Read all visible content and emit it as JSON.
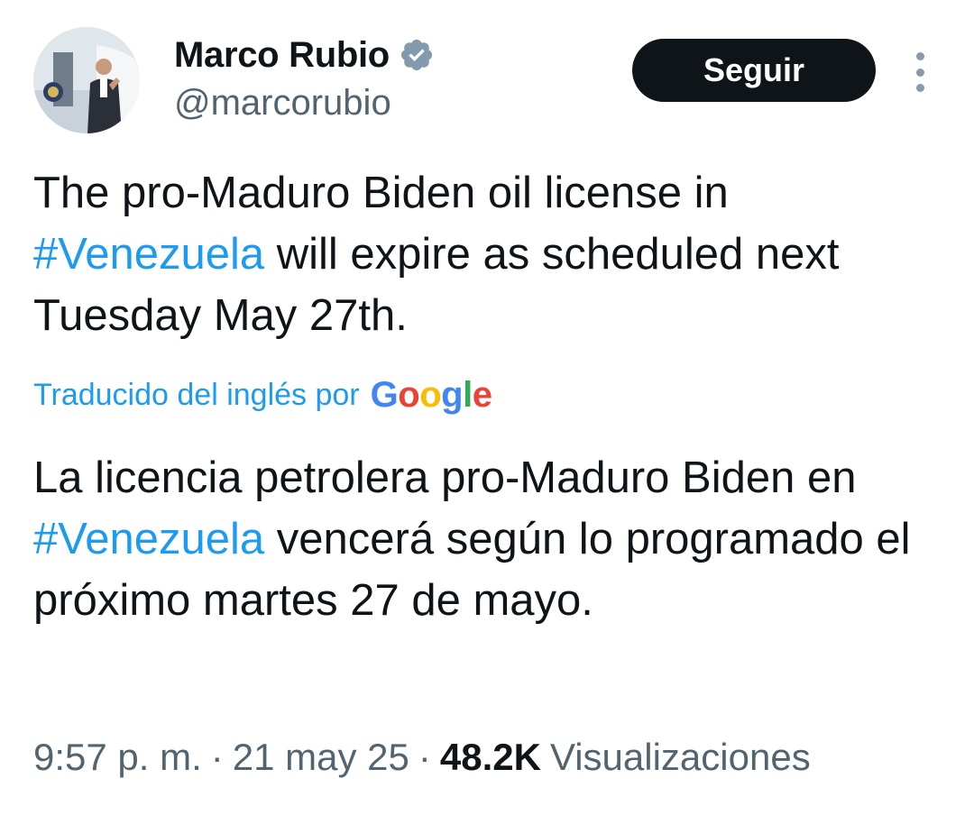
{
  "author": {
    "display_name": "Marco Rubio",
    "handle": "@marcorubio",
    "verified_icon": "verified-badge-icon",
    "verified_color": "#829aab"
  },
  "actions": {
    "follow_label": "Seguir",
    "more_icon": "more-vertical-icon"
  },
  "original": {
    "part1": "The pro-Maduro Biden oil  license in ",
    "hashtag": "#Venezuela",
    "part2": " will expire as scheduled next Tuesday May 27th."
  },
  "translation_note": {
    "label": "Traducido del inglés por",
    "provider": "Google"
  },
  "translated": {
    "part1": "La licencia petrolera pro-Maduro Biden en ",
    "hashtag": "#Venezuela",
    "part2": " vencerá según lo programado el próximo martes 27 de mayo."
  },
  "meta": {
    "time": "9:57 p. m.",
    "separator": "·",
    "date": "21 may 25",
    "views_count": "48.2K",
    "views_label": "Visualizaciones"
  },
  "colors": {
    "text": "#0f1419",
    "secondary": "#536471",
    "link": "#1d9bf0",
    "button_bg": "#0f1419",
    "button_text": "#ffffff"
  }
}
